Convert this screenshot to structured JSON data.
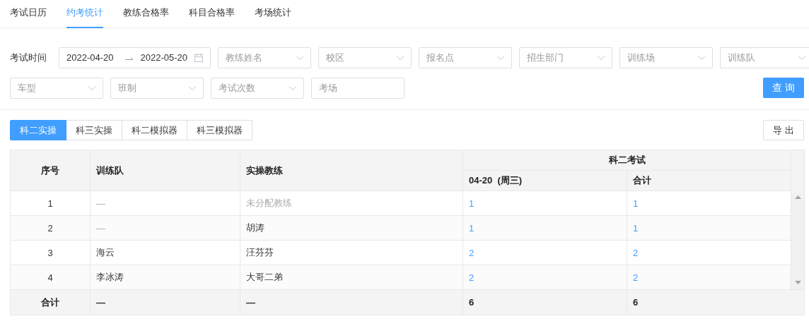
{
  "tabs": [
    {
      "label": "考试日历",
      "selected": false
    },
    {
      "label": "约考统计",
      "selected": true
    },
    {
      "label": "教练合格率",
      "selected": false
    },
    {
      "label": "科目合格率",
      "selected": false
    },
    {
      "label": "考场统计",
      "selected": false
    }
  ],
  "filters": {
    "date_label": "考试时间",
    "date_start": "2022-04-20",
    "date_end": "2022-05-20",
    "fields": [
      {
        "kind": "select",
        "placeholder": "教练姓名"
      },
      {
        "kind": "select",
        "placeholder": "校区"
      },
      {
        "kind": "select",
        "placeholder": "报名点"
      },
      {
        "kind": "select",
        "placeholder": "招生部门"
      },
      {
        "kind": "select",
        "placeholder": "训练场"
      },
      {
        "kind": "select",
        "placeholder": "训练队"
      },
      {
        "kind": "select",
        "placeholder": "车型"
      },
      {
        "kind": "select",
        "placeholder": "班制"
      },
      {
        "kind": "select",
        "placeholder": "考试次数"
      },
      {
        "kind": "input",
        "placeholder": "考场"
      }
    ],
    "query_button": "查 询"
  },
  "subject_tabs": [
    {
      "label": "科二实操",
      "selected": true
    },
    {
      "label": "科三实操",
      "selected": false
    },
    {
      "label": "科二模拟器",
      "selected": false
    },
    {
      "label": "科三模拟器",
      "selected": false
    }
  ],
  "export_button": "导 出",
  "table": {
    "columns": [
      "序号",
      "训练队",
      "实操教练"
    ],
    "group_header": "科二考试",
    "group_columns": [
      "04-20  (周三)",
      "合计"
    ],
    "rows": [
      {
        "index": "1",
        "team": "—",
        "team_muted": true,
        "coach": "未分配教练",
        "coach_muted": true,
        "day": "1",
        "total": "1"
      },
      {
        "index": "2",
        "team": "—",
        "team_muted": true,
        "coach": "胡涛",
        "coach_muted": false,
        "day": "1",
        "total": "1"
      },
      {
        "index": "3",
        "team": "海云",
        "team_muted": false,
        "coach": "汪芬芬",
        "coach_muted": false,
        "day": "2",
        "total": "2"
      },
      {
        "index": "4",
        "team": "李冰涛",
        "team_muted": false,
        "coach": "大哥二弟",
        "coach_muted": false,
        "day": "2",
        "total": "2"
      }
    ],
    "footer": {
      "label": "合计",
      "team": "—",
      "coach": "—",
      "day": "6",
      "total": "6"
    }
  }
}
